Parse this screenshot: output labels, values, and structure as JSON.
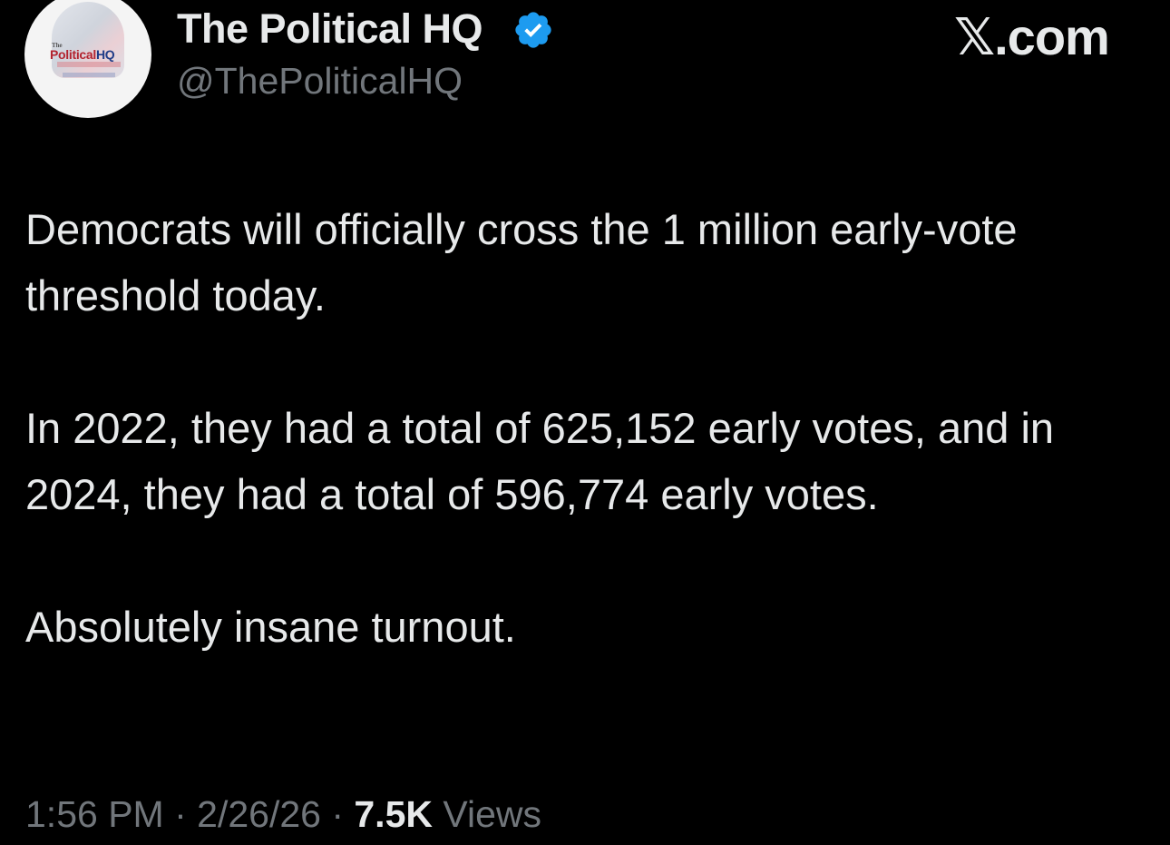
{
  "avatar": {
    "logo_small": "The",
    "logo_part1": "Political",
    "logo_part2": "HQ"
  },
  "author": {
    "display_name": "The Political HQ",
    "handle": "@ThePoliticalHQ",
    "verified_color": "#1d9bf0"
  },
  "brand": "𝕏.com",
  "tweet": {
    "paragraphs": [
      "Democrats will officially cross the 1 million early-vote threshold today.",
      "In 2022, they had a total of 625,152 early votes, and in 2024, they had a total of 596,774 early votes.",
      "Absolutely insane turnout."
    ]
  },
  "meta": {
    "time": "1:56 PM",
    "separator": " · ",
    "date": "2/26/26",
    "views_count": "7.5K",
    "views_label": " Views"
  },
  "colors": {
    "background": "#000000",
    "text_primary": "#e7e9ea",
    "text_secondary": "#71767b",
    "accent": "#1d9bf0"
  }
}
